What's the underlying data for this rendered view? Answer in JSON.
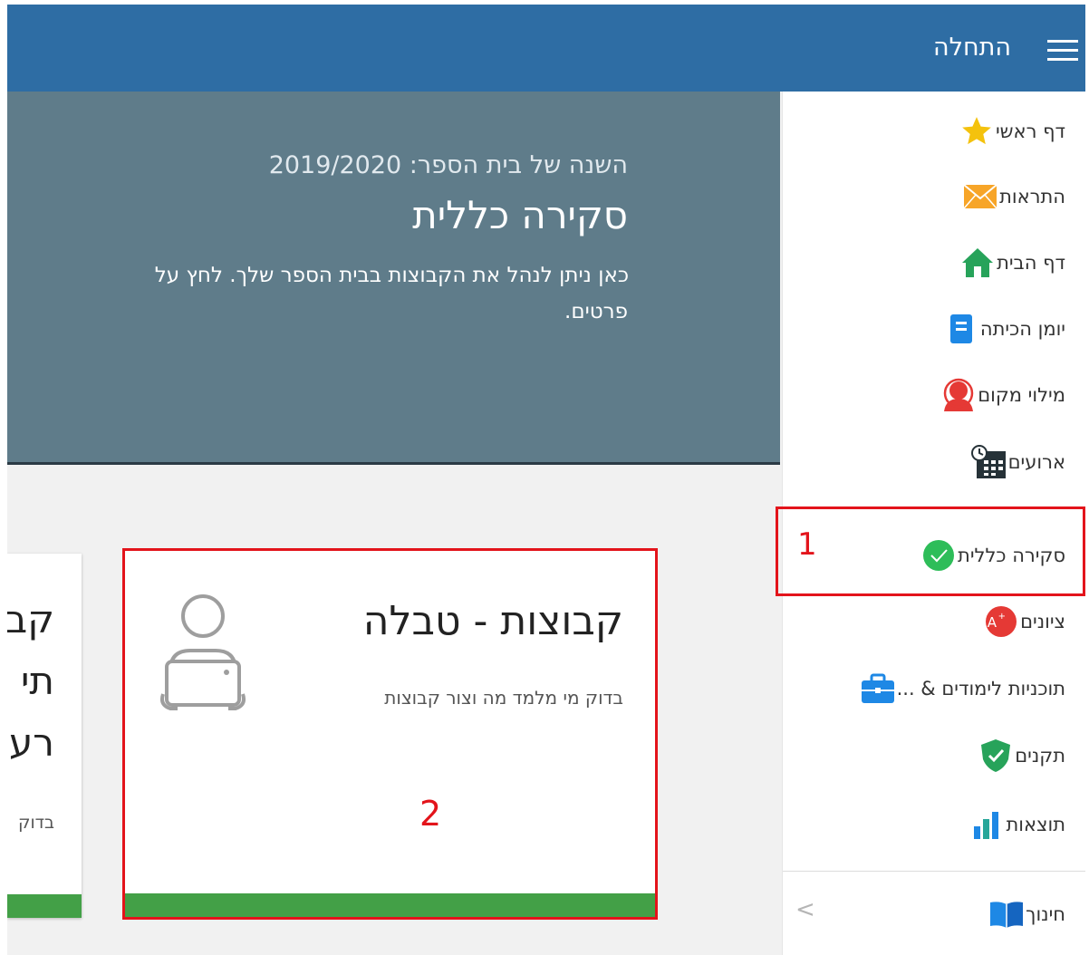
{
  "header": {
    "title": "התחלה"
  },
  "banner": {
    "year_line": "השנה של בית הספר: 2019/2020",
    "title": "סקירה כללית",
    "description_line1": "כאן ניתן לנהל את הקבוצות בבית הספר שלך. לחץ על",
    "description_line2": "פרטים."
  },
  "cards": [
    {
      "title": "קבוצות - טבלה",
      "description": "בדוק מי מלמד מה וצור קבוצות",
      "annotation": "2"
    },
    {
      "title_lines": [
        "קב",
        "תי",
        "רע"
      ],
      "description": "בדוק"
    }
  ],
  "sidebar": {
    "items": [
      {
        "label": "דף ראשי",
        "icon": "star-icon"
      },
      {
        "label": "התראות",
        "icon": "envelope-icon"
      },
      {
        "label": "דף הבית",
        "icon": "home-icon"
      },
      {
        "label": "יומן הכיתה",
        "icon": "notebook-icon"
      },
      {
        "label": "מילוי מקום",
        "icon": "substitute-person-icon"
      },
      {
        "label": "ארועים",
        "icon": "calendar-clock-icon"
      },
      {
        "label": "סקירה כללית",
        "icon": "check-circle-icon"
      },
      {
        "label": "ציונים",
        "icon": "grade-a-icon"
      },
      {
        "label": "תוכניות לימודים & ...",
        "icon": "briefcase-icon"
      },
      {
        "label": "תקנים",
        "icon": "shield-check-icon"
      },
      {
        "label": "תוצאות",
        "icon": "bar-chart-icon"
      }
    ],
    "footer_item": {
      "label": "חינוך",
      "icon": "open-book-icon"
    },
    "selected_annotation": "1",
    "collapse_glyph": "<"
  },
  "colors": {
    "topbar": "#2e6da4",
    "banner": "#5f7c8a",
    "accent_green": "#43a047",
    "annotation_red": "#e3141b"
  }
}
